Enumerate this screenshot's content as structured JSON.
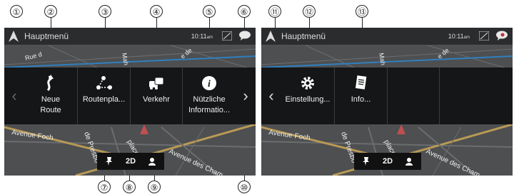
{
  "callouts": [
    "①",
    "②",
    "③",
    "④",
    "⑤",
    "⑥",
    "⑦",
    "⑧",
    "⑨",
    "⑩",
    "⑪",
    "⑫",
    "⑬"
  ],
  "screen_left": {
    "title": "Hauptmenü",
    "time": "10:11",
    "time_suffix": "am",
    "menu_items": [
      {
        "icon": "new-route-icon",
        "line1": "Neue",
        "line2": "Route"
      },
      {
        "icon": "route-planner-icon",
        "line1": "Routenpla...",
        "line2": ""
      },
      {
        "icon": "traffic-icon",
        "line1": "Verkehr",
        "line2": ""
      },
      {
        "icon": "info-icon",
        "line1": "Nützliche",
        "line2": "Informatio..."
      }
    ],
    "view_mode": "2D"
  },
  "screen_right": {
    "title": "Hauptmenü",
    "time": "10:11",
    "time_suffix": "am",
    "menu_items": [
      {
        "icon": "settings-icon",
        "line1": "Einstellung...",
        "line2": ""
      },
      {
        "icon": "info-document-icon",
        "line1": "Info...",
        "line2": ""
      }
    ],
    "view_mode": "2D"
  },
  "map_labels": [
    "Rue d",
    "Mah",
    "e de",
    "Avenue Foch",
    "de Presbo",
    "place",
    "Avenue des Cham",
    "Mah",
    "e de",
    "Avenue Foch",
    "de Presbo",
    "place",
    "Avenue des Cham"
  ]
}
